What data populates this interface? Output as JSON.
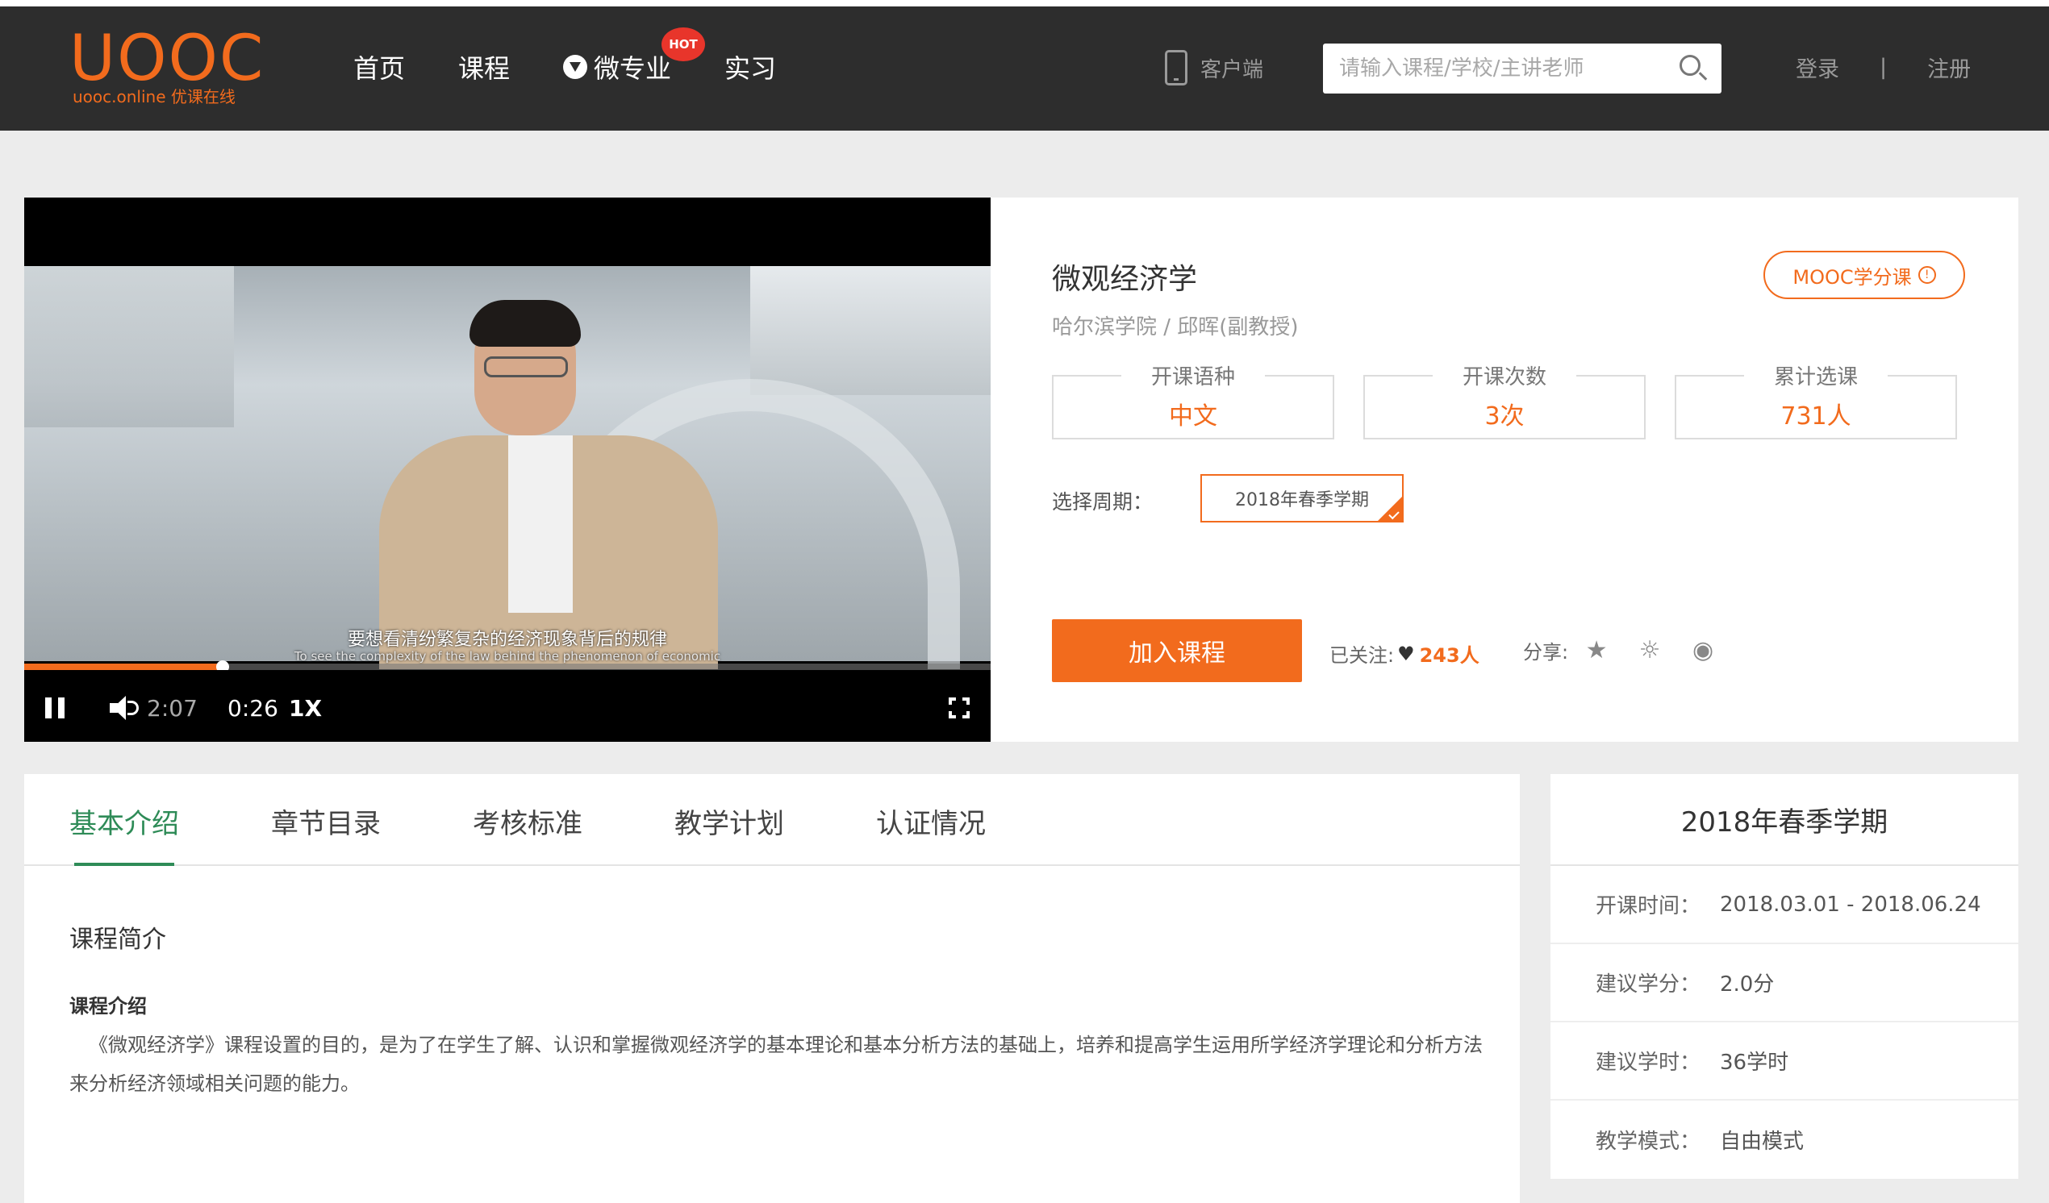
{
  "header": {
    "logo_text": "UOOC",
    "logo_sub": "uooc.online 优课在线",
    "nav": [
      {
        "label": "首页"
      },
      {
        "label": "课程"
      },
      {
        "label": "微专业",
        "badge": "HOT",
        "icon": "weizhuanye-icon"
      },
      {
        "label": "实习"
      }
    ],
    "client_label": "客户端",
    "search_placeholder": "请输入课程/学校/主讲老师",
    "login": "登录",
    "separator": "|",
    "register": "注册"
  },
  "video": {
    "subtitle_cn": "要想看清纷繁复杂的经济现象背后的规律",
    "subtitle_en": "To see the complexity of the law behind the phenomenon of economic",
    "total_time": "2:07",
    "current_time": "0:26",
    "rate": "1X",
    "progress_fraction": 0.205
  },
  "course": {
    "title": "微观经济学",
    "credit_button": "MOOC学分课",
    "credit_icon": "!",
    "school_teacher": "哈尔滨学院 / 邱晖(副教授)",
    "stats": [
      {
        "label": "开课语种",
        "value": "中文"
      },
      {
        "label": "开课次数",
        "value": "3次"
      },
      {
        "label": "累计选课",
        "value": "731人"
      }
    ],
    "period_label": "选择周期：",
    "period_value": "2018年春季学期",
    "join_button": "加入课程",
    "follow_label": "已关注:",
    "follow_count": "243人",
    "share_label": "分享:",
    "share_icons": [
      "qzone-star-icon",
      "weibo-icon",
      "wechat-icon"
    ]
  },
  "tabs": [
    {
      "label": "基本介绍",
      "active": true
    },
    {
      "label": "章节目录",
      "active": false
    },
    {
      "label": "考核标准",
      "active": false
    },
    {
      "label": "教学计划",
      "active": false
    },
    {
      "label": "认证情况",
      "active": false
    }
  ],
  "intro": {
    "section_title": "课程简介",
    "sub_title": "课程介绍",
    "paragraph": "《微观经济学》课程设置的目的，是为了在学生了解、认识和掌握微观经济学的基本理论和基本分析方法的基础上，培养和提高学生运用所学经济学理论和分析方法来分析经济领域相关问题的能力。"
  },
  "sidebar": {
    "title": "2018年春季学期",
    "rows": [
      {
        "key": "开课时间：",
        "value": "2018.03.01 - 2018.06.24"
      },
      {
        "key": "建议学分：",
        "value": "2.0分"
      },
      {
        "key": "建议学时：",
        "value": "36学时"
      },
      {
        "key": "教学模式：",
        "value": "自由模式"
      }
    ]
  },
  "colors": {
    "accent": "#f26b1d",
    "header_bg": "#2d2d2d",
    "tab_active": "#2e8b57",
    "page_bg": "#ececec"
  }
}
